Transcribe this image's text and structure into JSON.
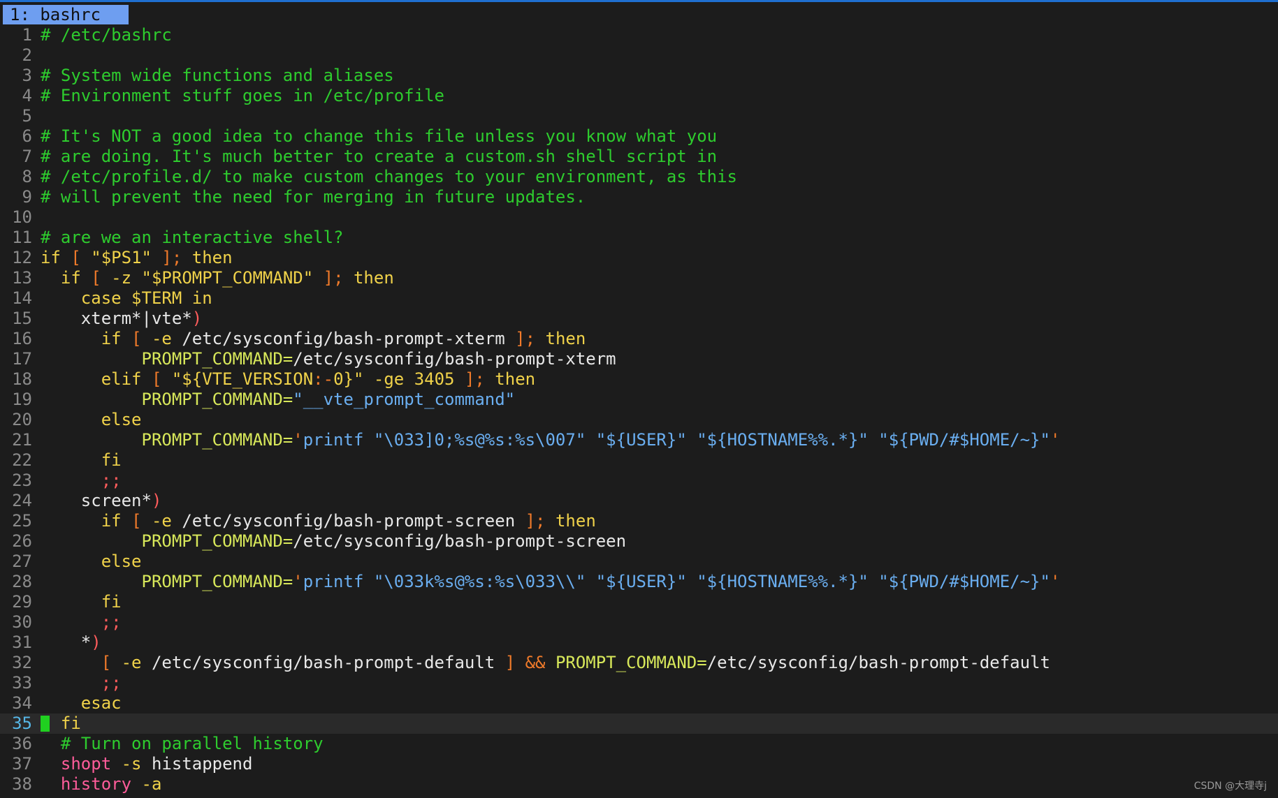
{
  "tab": {
    "label": "1: bashrc"
  },
  "watermark": "CSDN @大理寺j",
  "lines": [
    {
      "n": "1",
      "segs": [
        [
          "com",
          "# /etc/bashrc"
        ]
      ]
    },
    {
      "n": "2",
      "segs": []
    },
    {
      "n": "3",
      "segs": [
        [
          "com",
          "# System wide functions and aliases"
        ]
      ]
    },
    {
      "n": "4",
      "segs": [
        [
          "com",
          "# Environment stuff goes in /etc/profile"
        ]
      ]
    },
    {
      "n": "5",
      "segs": []
    },
    {
      "n": "6",
      "segs": [
        [
          "com",
          "# It's NOT a good idea to change this file unless you know what you"
        ]
      ]
    },
    {
      "n": "7",
      "segs": [
        [
          "com",
          "# are doing. It's much better to create a custom.sh shell script in"
        ]
      ]
    },
    {
      "n": "8",
      "segs": [
        [
          "com",
          "# /etc/profile.d/ to make custom changes to your environment, as this"
        ]
      ]
    },
    {
      "n": "9",
      "segs": [
        [
          "com",
          "# will prevent the need for merging in future updates."
        ]
      ]
    },
    {
      "n": "10",
      "segs": []
    },
    {
      "n": "11",
      "segs": [
        [
          "com",
          "# are we an interactive shell?"
        ]
      ]
    },
    {
      "n": "12",
      "segs": [
        [
          "kw",
          "if"
        ],
        [
          "pl",
          " "
        ],
        [
          "br",
          "["
        ],
        [
          "pl",
          " "
        ],
        [
          "str",
          "\"$PS1\""
        ],
        [
          "pl",
          " "
        ],
        [
          "br",
          "];"
        ],
        [
          "pl",
          " "
        ],
        [
          "kw",
          "then"
        ]
      ]
    },
    {
      "n": "13",
      "segs": [
        [
          "pl",
          "  "
        ],
        [
          "kw",
          "if"
        ],
        [
          "pl",
          " "
        ],
        [
          "br",
          "["
        ],
        [
          "pl",
          " "
        ],
        [
          "kw",
          "-z"
        ],
        [
          "pl",
          " "
        ],
        [
          "str",
          "\"$PROMPT_COMMAND\""
        ],
        [
          "pl",
          " "
        ],
        [
          "br",
          "];"
        ],
        [
          "pl",
          " "
        ],
        [
          "kw",
          "then"
        ]
      ]
    },
    {
      "n": "14",
      "segs": [
        [
          "pl",
          "    "
        ],
        [
          "kw",
          "case"
        ],
        [
          "pl",
          " "
        ],
        [
          "ident",
          "$TERM"
        ],
        [
          "pl",
          " "
        ],
        [
          "kw",
          "in"
        ]
      ]
    },
    {
      "n": "15",
      "segs": [
        [
          "pl",
          "    xterm*|vte*"
        ],
        [
          "pat",
          ")"
        ]
      ]
    },
    {
      "n": "16",
      "segs": [
        [
          "pl",
          "      "
        ],
        [
          "kw",
          "if"
        ],
        [
          "pl",
          " "
        ],
        [
          "br",
          "["
        ],
        [
          "pl",
          " "
        ],
        [
          "kw",
          "-e"
        ],
        [
          "pl",
          " /etc/sysconfig/bash-prompt-xterm "
        ],
        [
          "br",
          "];"
        ],
        [
          "pl",
          " "
        ],
        [
          "kw",
          "then"
        ]
      ]
    },
    {
      "n": "17",
      "segs": [
        [
          "pl",
          "          "
        ],
        [
          "asg",
          "PROMPT_COMMAND="
        ],
        [
          "pl",
          "/etc/sysconfig/bash-prompt-xterm"
        ]
      ]
    },
    {
      "n": "18",
      "segs": [
        [
          "pl",
          "      "
        ],
        [
          "kw",
          "elif"
        ],
        [
          "pl",
          " "
        ],
        [
          "br",
          "["
        ],
        [
          "pl",
          " "
        ],
        [
          "str",
          "\"${VTE_VERSION"
        ],
        [
          "op",
          ":-"
        ],
        [
          "str",
          "0}\""
        ],
        [
          "pl",
          " "
        ],
        [
          "kw",
          "-ge"
        ],
        [
          "pl",
          " "
        ],
        [
          "num",
          "3405"
        ],
        [
          "pl",
          " "
        ],
        [
          "br",
          "];"
        ],
        [
          "pl",
          " "
        ],
        [
          "kw",
          "then"
        ]
      ]
    },
    {
      "n": "19",
      "segs": [
        [
          "pl",
          "          "
        ],
        [
          "asg",
          "PROMPT_COMMAND="
        ],
        [
          "sq",
          "\"__vte_prompt_command\""
        ]
      ]
    },
    {
      "n": "20",
      "segs": [
        [
          "pl",
          "      "
        ],
        [
          "kw",
          "else"
        ]
      ]
    },
    {
      "n": "21",
      "segs": [
        [
          "pl",
          "          "
        ],
        [
          "asg",
          "PROMPT_COMMAND="
        ],
        [
          "op",
          "'"
        ],
        [
          "sq",
          "printf \"\\033]0;%s@%s:%s\\007\" \"${USER}\" \"${HOSTNAME%%.*}\" \"${PWD/#$HOME/~}\""
        ],
        [
          "op",
          "'"
        ]
      ]
    },
    {
      "n": "22",
      "segs": [
        [
          "pl",
          "      "
        ],
        [
          "kw",
          "fi"
        ]
      ]
    },
    {
      "n": "23",
      "segs": [
        [
          "pl",
          "      "
        ],
        [
          "pat",
          ";;"
        ]
      ]
    },
    {
      "n": "24",
      "segs": [
        [
          "pl",
          "    screen*"
        ],
        [
          "pat",
          ")"
        ]
      ]
    },
    {
      "n": "25",
      "segs": [
        [
          "pl",
          "      "
        ],
        [
          "kw",
          "if"
        ],
        [
          "pl",
          " "
        ],
        [
          "br",
          "["
        ],
        [
          "pl",
          " "
        ],
        [
          "kw",
          "-e"
        ],
        [
          "pl",
          " /etc/sysconfig/bash-prompt-screen "
        ],
        [
          "br",
          "];"
        ],
        [
          "pl",
          " "
        ],
        [
          "kw",
          "then"
        ]
      ]
    },
    {
      "n": "26",
      "segs": [
        [
          "pl",
          "          "
        ],
        [
          "asg",
          "PROMPT_COMMAND="
        ],
        [
          "pl",
          "/etc/sysconfig/bash-prompt-screen"
        ]
      ]
    },
    {
      "n": "27",
      "segs": [
        [
          "pl",
          "      "
        ],
        [
          "kw",
          "else"
        ]
      ]
    },
    {
      "n": "28",
      "segs": [
        [
          "pl",
          "          "
        ],
        [
          "asg",
          "PROMPT_COMMAND="
        ],
        [
          "op",
          "'"
        ],
        [
          "sq",
          "printf \"\\033k%s@%s:%s\\033\\\\\" \"${USER}\" \"${HOSTNAME%%.*}\" \"${PWD/#$HOME/~}\""
        ],
        [
          "op",
          "'"
        ]
      ]
    },
    {
      "n": "29",
      "segs": [
        [
          "pl",
          "      "
        ],
        [
          "kw",
          "fi"
        ]
      ]
    },
    {
      "n": "30",
      "segs": [
        [
          "pl",
          "      "
        ],
        [
          "pat",
          ";;"
        ]
      ]
    },
    {
      "n": "31",
      "segs": [
        [
          "pl",
          "    *"
        ],
        [
          "pat",
          ")"
        ]
      ]
    },
    {
      "n": "32",
      "segs": [
        [
          "pl",
          "      "
        ],
        [
          "br",
          "["
        ],
        [
          "pl",
          " "
        ],
        [
          "kw",
          "-e"
        ],
        [
          "pl",
          " /etc/sysconfig/bash-prompt-default "
        ],
        [
          "br",
          "]"
        ],
        [
          "pl",
          " "
        ],
        [
          "op",
          "&&"
        ],
        [
          "pl",
          " "
        ],
        [
          "asg",
          "PROMPT_COMMAND="
        ],
        [
          "pl",
          "/etc/sysconfig/bash-prompt-default"
        ]
      ]
    },
    {
      "n": "33",
      "segs": [
        [
          "pl",
          "      "
        ],
        [
          "pat",
          ";;"
        ]
      ]
    },
    {
      "n": "34",
      "segs": [
        [
          "pl",
          "    "
        ],
        [
          "kw",
          "esac"
        ]
      ]
    },
    {
      "n": "35",
      "current": true,
      "segs": [
        [
          "pl",
          "  "
        ],
        [
          "kw",
          "fi"
        ]
      ]
    },
    {
      "n": "36",
      "segs": [
        [
          "pl",
          "  "
        ],
        [
          "com",
          "# Turn on parallel history"
        ]
      ]
    },
    {
      "n": "37",
      "segs": [
        [
          "pl",
          "  "
        ],
        [
          "cmd",
          "shopt"
        ],
        [
          "pl",
          " "
        ],
        [
          "kw",
          "-s"
        ],
        [
          "pl",
          " histappend"
        ]
      ]
    },
    {
      "n": "38",
      "segs": [
        [
          "pl",
          "  "
        ],
        [
          "cmd",
          "history"
        ],
        [
          "pl",
          " "
        ],
        [
          "kw",
          "-a"
        ]
      ]
    }
  ]
}
